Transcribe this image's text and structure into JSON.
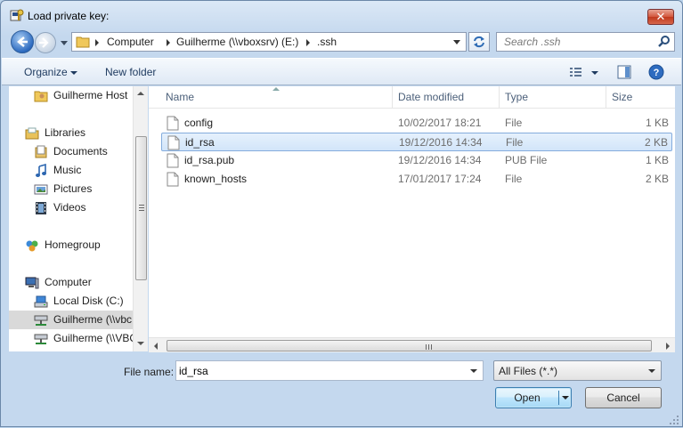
{
  "window": {
    "title": "Load private key:",
    "close_label": "✕"
  },
  "address": {
    "crumbs": [
      "Computer",
      "Guilherme (\\\\vboxsrv) (E:)",
      ".ssh"
    ]
  },
  "search": {
    "placeholder": "Search .ssh"
  },
  "toolbar": {
    "organize": "Organize",
    "new_folder": "New folder"
  },
  "sidebar": {
    "items": [
      {
        "label": "Guilherme Host",
        "icon": "user-folder-icon"
      },
      {
        "label": "Libraries",
        "icon": "libraries-icon"
      },
      {
        "label": "Documents",
        "icon": "documents-icon"
      },
      {
        "label": "Music",
        "icon": "music-icon"
      },
      {
        "label": "Pictures",
        "icon": "pictures-icon"
      },
      {
        "label": "Videos",
        "icon": "videos-icon"
      },
      {
        "label": "Homegroup",
        "icon": "homegroup-icon"
      },
      {
        "label": "Computer",
        "icon": "computer-icon"
      },
      {
        "label": "Local Disk (C:)",
        "icon": "local-disk-icon"
      },
      {
        "label": "Guilherme (\\\\vbc",
        "icon": "network-drive-icon"
      },
      {
        "label": "Guilherme (\\\\VBC",
        "icon": "network-drive-icon"
      }
    ]
  },
  "columns": {
    "name": "Name",
    "date": "Date modified",
    "type": "Type",
    "size": "Size"
  },
  "files": [
    {
      "name": "config",
      "date": "10/02/2017 18:21",
      "type": "File",
      "size": "1 KB"
    },
    {
      "name": "id_rsa",
      "date": "19/12/2016 14:34",
      "type": "File",
      "size": "2 KB"
    },
    {
      "name": "id_rsa.pub",
      "date": "19/12/2016 14:34",
      "type": "PUB File",
      "size": "1 KB"
    },
    {
      "name": "known_hosts",
      "date": "17/01/2017 17:24",
      "type": "File",
      "size": "2 KB"
    }
  ],
  "filename": {
    "label": "File name:",
    "value": "id_rsa"
  },
  "filter": {
    "value": "All Files (*.*)"
  },
  "buttons": {
    "open": "Open",
    "cancel": "Cancel"
  },
  "colors": {
    "selection_border": "#84acdd",
    "selection_fill": "#d9e8fb",
    "close_red": "#c7452a"
  }
}
